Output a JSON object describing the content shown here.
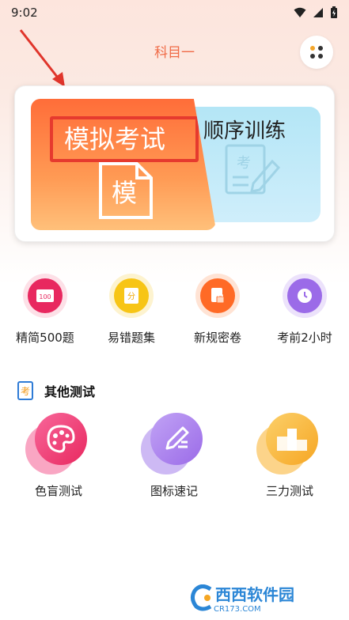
{
  "status_bar": {
    "time": "9:02"
  },
  "header": {
    "title": "科目一"
  },
  "mode_card": {
    "mock_exam_label": "模拟考试",
    "mock_doc_char": "模",
    "sequential_label": "顺序训练",
    "sequential_doc_char": "考"
  },
  "quick_features": [
    {
      "label": "精简500题",
      "icon_text": "100",
      "icon": "book-icon",
      "color": "#e8285f"
    },
    {
      "label": "易错题集",
      "icon_text": "分",
      "icon": "score-icon",
      "color": "#f7c516"
    },
    {
      "label": "新规密卷",
      "icon_text": "",
      "icon": "lock-doc-icon",
      "color": "#ff6a26"
    },
    {
      "label": "考前2小时",
      "icon_text": "",
      "icon": "clock-icon",
      "color": "#9b6be8"
    }
  ],
  "other_tests": {
    "title": "其他测试",
    "section_icon_char": "考",
    "items": [
      {
        "label": "色盲测试",
        "icon": "palette-icon",
        "color": "#f0427e"
      },
      {
        "label": "图标速记",
        "icon": "pencil-icon",
        "color": "#a57ee6"
      },
      {
        "label": "三力测试",
        "icon": "podium-icon",
        "color": "#f9b233"
      }
    ]
  },
  "watermark": {
    "brand": "西西软件园",
    "url": "CR173.COM"
  }
}
